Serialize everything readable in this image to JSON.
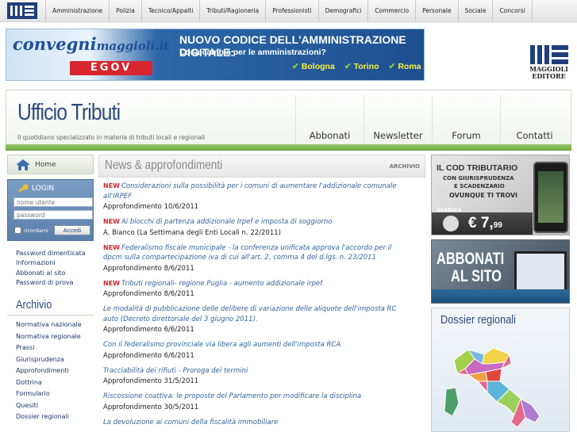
{
  "topnav": {
    "items": [
      "Amministrazione",
      "Polizia",
      "Tecnico/Appalti",
      "Tributi/Ragioneria",
      "Professionisti",
      "Demografici",
      "Commercio",
      "Personale",
      "Sociale",
      "Concorsi"
    ]
  },
  "banner": {
    "brand_main": "convegni",
    "brand_sub": "maggioli.it",
    "egov": "EGOV",
    "headline": "NUOVO CODICE DELL'AMMINISTRAZIONE DIGITALE:",
    "subhead": "Cosa cambia per le amministrazioni?",
    "cities": [
      "Bologna",
      "Torino",
      "Roma"
    ]
  },
  "publisher": {
    "name_line1": "MAGGIOLI",
    "name_line2": "EDITORE"
  },
  "header": {
    "title": "Ufficio Tributi",
    "tagline": "Il quotidiano specializzato in materia di tributi locali e regionali",
    "nav": [
      "Abbonati",
      "Newsletter",
      "Forum",
      "Contatti"
    ]
  },
  "sidebar": {
    "home": "Home",
    "login": {
      "title": "LOGIN",
      "username_placeholder": "nome utente",
      "password_placeholder": "password",
      "remember": "ricordami",
      "submit": "Accedi"
    },
    "account_links": [
      "Password dimenticata",
      "Informazioni",
      "Abbonati al sito",
      "Password di prova"
    ],
    "archive_title": "Archivio",
    "archive_links": [
      "Normativa nazionale",
      "Normativa regionale",
      "Prassi",
      "Giurisprudenza",
      "Approfondimenti",
      "Dottrina",
      "Formulario",
      "Quesiti",
      "Dossier regionali"
    ]
  },
  "news": {
    "title": "News & approfondimenti",
    "archive_link": "ARCHIVIO",
    "new_label": "NEW",
    "items": [
      {
        "headline": "Considerazioni sulla possibilità per i comuni di aumentare l'addizionale comunale all'IRPEF",
        "meta": "Approfondimento 10/6/2011"
      },
      {
        "headline": "Ai blocchi di partenza addizionale Irpef e imposta di soggiorno",
        "meta": "A. Bianco (La Settimana degli Enti Locali n. 22/2011)"
      },
      {
        "headline": "Federalismo fiscale municipale - la conferenza unificata approva l'accordo per il dpcm sulla compartecipazione iva di cui all'art. 2, comma 4 del d.lgs. n. 23/2011",
        "meta": "Approfondimento 8/6/2011"
      },
      {
        "headline": "Tributi regionali- regione Puglia - aumento addizionale irpef",
        "meta": "Approfondimento 8/6/2011"
      },
      {
        "headline": "Le modalità di pubblicazione delle delibere di variazione delle aliquote dell'imposta RC auto (Decreto direttoriale del 3 giugno 2011).",
        "meta": "Approfondimento 6/6/2011"
      },
      {
        "headline": "Con il federalismo provinciale via libera agli aumenti dell'imposta RCA",
        "meta": "Approfondimento 6/6/2011"
      },
      {
        "headline": "Tracciabilità dei rifiuti - Proroga dei termini",
        "meta": "Approfondimento 31/5/2011"
      },
      {
        "headline": "Riscossione coattiva: le proposte del Parlamento per modificare la disciplina",
        "meta": "Approfondimento 30/5/2011"
      },
      {
        "headline": "La devoluzione ai comuni della fiscalità immobiliare",
        "meta": ""
      }
    ]
  },
  "ads": {
    "cod": {
      "title": "IL COD TRIBUTARIO",
      "line1": "CON GIURISPRUDENZA",
      "line2": "E SCADENZARIO",
      "line3": "OVUNQUE TI TROVI",
      "download": "SCARICA",
      "price": "€ 7,",
      "price_cents": "99"
    },
    "abbonati": {
      "line1": "ABBONATI",
      "line2": "AL SITO"
    }
  },
  "dossier": {
    "title": "Dossier regionali"
  },
  "colors": {
    "accent_blue": "#2c4a7f",
    "link_blue": "#34629c",
    "new_red": "#d0262e",
    "green_bar": "#6aa93f"
  }
}
